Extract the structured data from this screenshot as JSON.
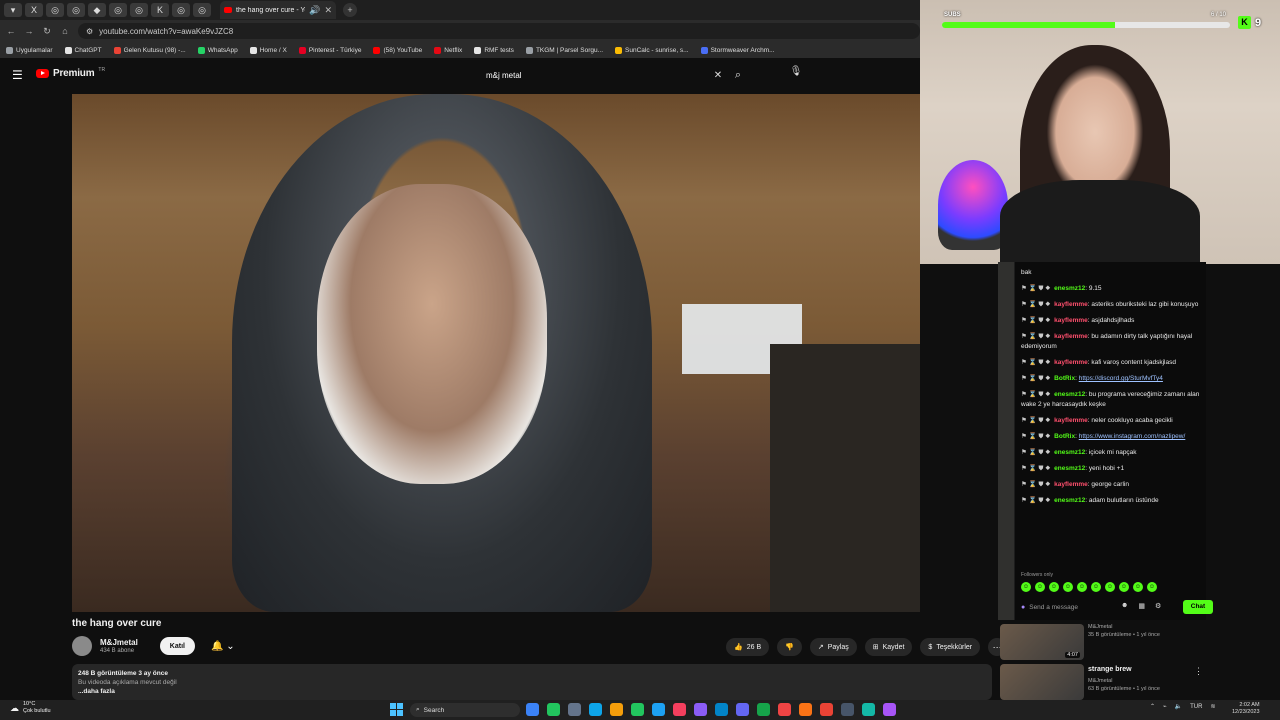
{
  "browser": {
    "tab_favicons": [
      "▾",
      "X",
      "◎",
      "◎",
      "◆",
      "◎",
      "◎",
      "K",
      "◎",
      "◎"
    ],
    "active_tab": {
      "title": "the hang over cure - YouTube"
    },
    "address": "youtube.com/watch?v=awaKe9vJZC8",
    "bookmarks": [
      {
        "label": "Uygulamalar",
        "color": "#9aa0a6"
      },
      {
        "label": "ChatGPT",
        "color": "#e5e5e5"
      },
      {
        "label": "Gelen Kutusu (98) -...",
        "color": "#ea4335"
      },
      {
        "label": "WhatsApp",
        "color": "#25d366"
      },
      {
        "label": "Home / X",
        "color": "#e5e5e5"
      },
      {
        "label": "Pinterest - Türkiye",
        "color": "#e60023"
      },
      {
        "label": "(58) YouTube",
        "color": "#ff0000"
      },
      {
        "label": "Netflix",
        "color": "#e50914"
      },
      {
        "label": "RMF tests",
        "color": "#e5e5e5"
      },
      {
        "label": "TKGM | Parsel Sorgu...",
        "color": "#9aa0a6"
      },
      {
        "label": "SunCalc - sunrise, s...",
        "color": "#fbbc04"
      },
      {
        "label": "Stormweaver Archm...",
        "color": "#4a6ef5"
      }
    ]
  },
  "youtube": {
    "logo_text": "Premium",
    "logo_region": "TR",
    "search_value": "m&j metal",
    "video": {
      "title": "the hang over cure",
      "channel": "M&Jmetal",
      "subscribers": "434 B abone",
      "join_label": "Katıl",
      "likes": "26 B",
      "share_label": "Paylaş",
      "save_label": "Kaydet",
      "thanks_label": "Teşekkürler",
      "views_line": "248 B görüntüleme  3 ay önce",
      "no_desc": "Bu videoda açıklama mevcut değil",
      "more_label": "...daha fazla"
    },
    "related": [
      {
        "title": "",
        "channel": "M&Jmetal",
        "meta": "35 B görüntüleme • 1 yıl önce",
        "duration": "4:07"
      },
      {
        "title": "strange brew",
        "channel": "M&Jmetal",
        "meta": "63 B görüntüleme • 1 yıl önce",
        "duration": ""
      }
    ]
  },
  "stream": {
    "subs_label": "SUBS",
    "subs_count": "6 / 10",
    "subs_progress": 0.6,
    "kick_viewers": "9",
    "accent": "#53fc18"
  },
  "chat": {
    "messages": [
      {
        "user": "",
        "color": "#ffffff",
        "text": "bak"
      },
      {
        "user": "enesmz12",
        "color": "#53fc18",
        "text": "9.15"
      },
      {
        "user": "kayflemme",
        "color": "#ff4f6d",
        "text": "asteriks oburiksteki laz gibi konuşuyo"
      },
      {
        "user": "kayflemme",
        "color": "#ff4f6d",
        "text": "asjdahdsjlhads"
      },
      {
        "user": "kayflemme",
        "color": "#ff4f6d",
        "text": "bu adamın dirty talk yaptığını hayal edemiyorum"
      },
      {
        "user": "kayflemme",
        "color": "#ff4f6d",
        "text": "kafi varoş content kjadskjlasd"
      },
      {
        "user": "BotRix",
        "color": "#53fc18",
        "text": "",
        "link": "https://discord.gg/SturMvfTy4"
      },
      {
        "user": "enesmz12",
        "color": "#53fc18",
        "text": "bu programa vereceğimiz zamanı alan wake 2 ye harcasaydık keşke"
      },
      {
        "user": "kayflemme",
        "color": "#ff4f6d",
        "text": "neler cookluyo acaba gecikli"
      },
      {
        "user": "BotRix",
        "color": "#53fc18",
        "text": "",
        "link": "https://www.instagram.com/nazlipew/"
      },
      {
        "user": "enesmz12",
        "color": "#53fc18",
        "text": "içicek mi napçak"
      },
      {
        "user": "enesmz12",
        "color": "#53fc18",
        "text": "yeni hobi +1"
      },
      {
        "user": "kayflemme",
        "color": "#ff4f6d",
        "text": "george carlin"
      },
      {
        "user": "enesmz12",
        "color": "#53fc18",
        "text": "adam bulutların üstünde"
      }
    ],
    "followers_only": "Followers only",
    "input_placeholder": "Send a message",
    "chat_button": "Chat"
  },
  "taskbar": {
    "weather_temp": "10°C",
    "weather_desc": "Çok bulutlu",
    "search_label": "Search",
    "language": "TUR",
    "time": "2:02 AM",
    "date": "12/23/2023"
  }
}
